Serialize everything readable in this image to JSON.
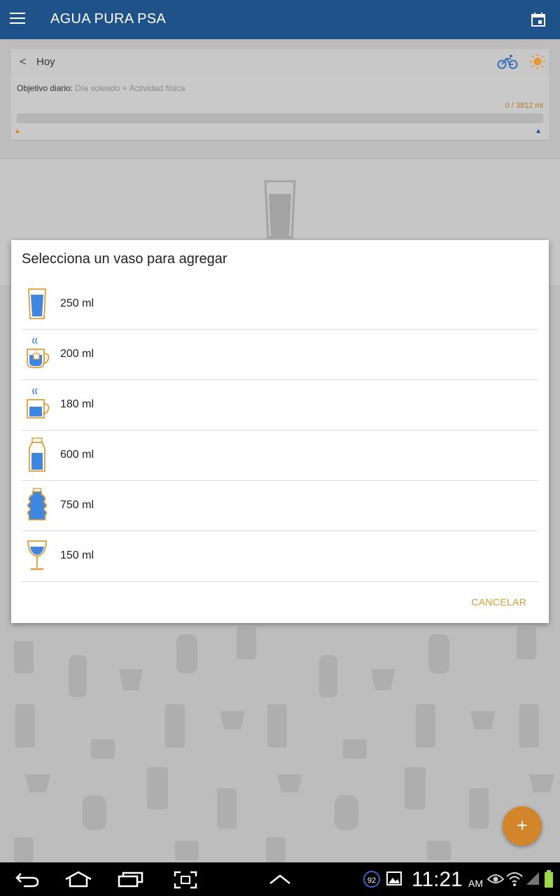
{
  "app": {
    "title": "AGUA PURA PSA"
  },
  "day": {
    "prev_glyph": "<",
    "label": "Hoy"
  },
  "goal": {
    "label": "Objetivo diario:",
    "value": "Día soleado + Actividad física",
    "amount": "0 / 3812 ml",
    "progress": 0
  },
  "dialog": {
    "title": "Selecciona un vaso para agregar",
    "options": [
      {
        "label": "250 ml",
        "icon": "glass-icon"
      },
      {
        "label": "200 ml",
        "icon": "tea-cup-icon"
      },
      {
        "label": "180 ml",
        "icon": "mug-icon"
      },
      {
        "label": "600 ml",
        "icon": "bottle-icon"
      },
      {
        "label": "750 ml",
        "icon": "large-bottle-icon"
      },
      {
        "label": "150 ml",
        "icon": "wine-glass-icon"
      }
    ],
    "cancel_label": "CANCELAR"
  },
  "fab": {
    "label": "+"
  },
  "status_bar": {
    "notification_count": "92",
    "time": "11:21",
    "ampm": "AM"
  },
  "colors": {
    "app_bar": "#20528a",
    "accent": "#d3852b",
    "water": "#3f86e0",
    "outline": "#e19b35"
  }
}
